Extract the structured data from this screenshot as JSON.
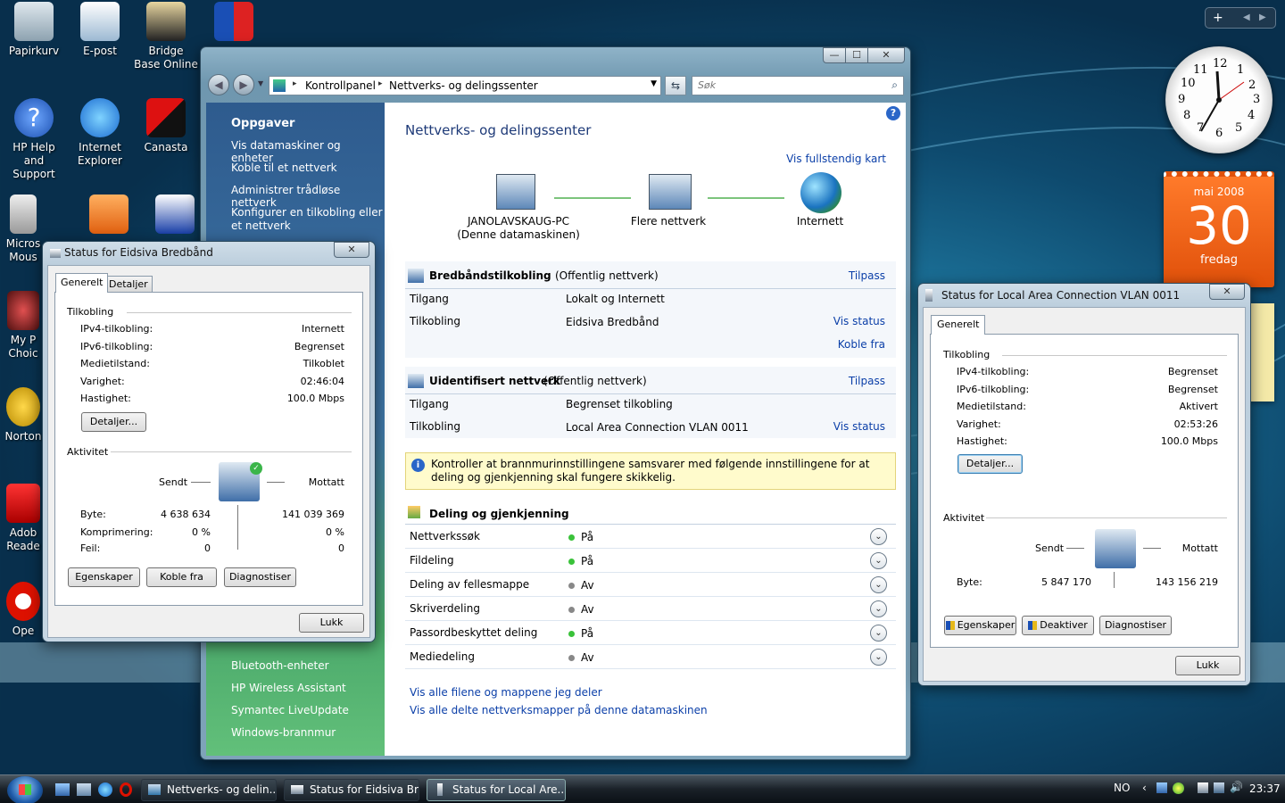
{
  "desktop": {
    "icons": [
      "Papirkurv",
      "E-post",
      "Bridge Base Online",
      "HP Help and Support",
      "Internet Explorer",
      "Canasta",
      "Microsoft Mouse",
      "My Photo Choice",
      "Norton",
      "Adobe Reader",
      "Opera"
    ],
    "icon_labels": {
      "papirkurv": "Papirkurv",
      "epost": "E-post",
      "bridge": "Bridge Base Online",
      "hphelp": "HP Help and Support",
      "ie": "Internet Explorer",
      "canasta": "Canasta",
      "mouse": "Micros Mous",
      "photo": "My P Choic",
      "norton": "Norton",
      "adobe": "Adob Reade",
      "opera": "Ope"
    }
  },
  "gadgets": {
    "calendar": {
      "month": "mai 2008",
      "day": "30",
      "weekday": "fredag"
    },
    "clock": {
      "numerals": [
        "12",
        "1",
        "2",
        "3",
        "4",
        "5",
        "6",
        "7",
        "8",
        "9",
        "10",
        "11"
      ]
    }
  },
  "main": {
    "address": {
      "root": "Kontrollpanel",
      "current": "Nettverks- og delingssenter"
    },
    "search_placeholder": "Søk",
    "help": "?",
    "sidebar": {
      "title": "Oppgaver",
      "tasks": [
        "Vis datamaskiner og enheter",
        "Koble til et nettverk",
        "Administrer trådløse nettverk",
        "Konfigurer en tilkobling eller et nettverk"
      ],
      "bottom": [
        "Bluetooth-enheter",
        "HP Wireless Assistant",
        "Symantec LiveUpdate",
        "Windows-brannmur"
      ]
    },
    "title": "Nettverks- og delingssenter",
    "full_map": "Vis fullstendig kart",
    "map": {
      "pc": "JANOLAVSKAUG-PC",
      "pc_sub": "(Denne datamaskinen)",
      "multi": "Flere nettverk",
      "internet": "Internett"
    },
    "net1": {
      "name": "Bredbåndstilkobling",
      "type": "(Offentlig nettverk)",
      "customize": "Tilpass",
      "access_label": "Tilgang",
      "access_value": "Lokalt og Internett",
      "conn_label": "Tilkobling",
      "conn_value": "Eidsiva Bredbånd",
      "status": "Vis status",
      "disconnect": "Koble fra"
    },
    "net2": {
      "name": "Uidentifisert nettverk",
      "type": "(Offentlig nettverk)",
      "customize": "Tilpass",
      "access_label": "Tilgang",
      "access_value": "Begrenset tilkobling",
      "conn_label": "Tilkobling",
      "conn_value": "Local Area Connection VLAN 0011",
      "status": "Vis status"
    },
    "warning": "Kontroller at brannmurinnstillingene samsvarer med følgende innstillingene for at deling og gjenkjenning skal fungere skikkelig.",
    "sharing": {
      "title": "Deling og gjenkjenning",
      "items": [
        {
          "label": "Nettverkssøk",
          "value": "På",
          "on": true
        },
        {
          "label": "Fildeling",
          "value": "På",
          "on": true
        },
        {
          "label": "Deling av fellesmappe",
          "value": "Av",
          "on": false
        },
        {
          "label": "Skriverdeling",
          "value": "Av",
          "on": false
        },
        {
          "label": "Passordbeskyttet deling",
          "value": "På",
          "on": true
        },
        {
          "label": "Mediedeling",
          "value": "Av",
          "on": false
        }
      ]
    },
    "links": [
      "Vis alle filene og mappene jeg deler",
      "Vis alle delte nettverksmapper på denne datamaskinen"
    ]
  },
  "dlg1": {
    "title": "Status for Eidsiva Bredbånd",
    "tabs": [
      "Generelt",
      "Detaljer"
    ],
    "conn_header": "Tilkobling",
    "rows": [
      {
        "label": "IPv4-tilkobling:",
        "value": "Internett"
      },
      {
        "label": "IPv6-tilkobling:",
        "value": "Begrenset"
      },
      {
        "label": "Medietilstand:",
        "value": "Tilkoblet"
      },
      {
        "label": "Varighet:",
        "value": "02:46:04"
      },
      {
        "label": "Hastighet:",
        "value": "100.0 Mbps"
      }
    ],
    "details": "Detaljer...",
    "activity": "Aktivitet",
    "sent": "Sendt",
    "received": "Mottatt",
    "stats": [
      {
        "label": "Byte:",
        "sent": "4 638 634",
        "recv": "141 039 369"
      },
      {
        "label": "Komprimering:",
        "sent": "0 %",
        "recv": "0 %"
      },
      {
        "label": "Feil:",
        "sent": "0",
        "recv": "0"
      }
    ],
    "buttons": [
      "Egenskaper",
      "Koble fra",
      "Diagnostiser"
    ],
    "close": "Lukk"
  },
  "dlg2": {
    "title": "Status for Local Area Connection VLAN 0011",
    "tabs": [
      "Generelt"
    ],
    "conn_header": "Tilkobling",
    "rows": [
      {
        "label": "IPv4-tilkobling:",
        "value": "Begrenset"
      },
      {
        "label": "IPv6-tilkobling:",
        "value": "Begrenset"
      },
      {
        "label": "Medietilstand:",
        "value": "Aktivert"
      },
      {
        "label": "Varighet:",
        "value": "02:53:26"
      },
      {
        "label": "Hastighet:",
        "value": "100.0 Mbps"
      }
    ],
    "details": "Detaljer...",
    "activity": "Aktivitet",
    "sent": "Sendt",
    "received": "Mottatt",
    "stats": [
      {
        "label": "Byte:",
        "sent": "5 847 170",
        "recv": "143 156 219"
      }
    ],
    "buttons": [
      "Egenskaper",
      "Deaktiver",
      "Diagnostiser"
    ],
    "close": "Lukk"
  },
  "taskbar": {
    "items": [
      "Nettverks- og delin...",
      "Status for Eidsiva Br...",
      "Status for Local Are..."
    ],
    "lang": "NO",
    "time": "23:37"
  }
}
